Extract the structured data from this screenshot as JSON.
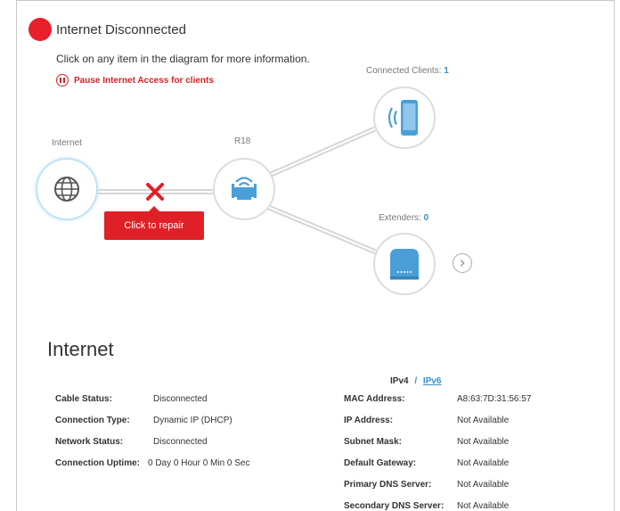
{
  "status": {
    "text": "Internet Disconnected",
    "instruction": "Click on any item in the diagram for more information.",
    "pause_label": "Pause Internet Access for clients"
  },
  "diagram": {
    "internet_label": "Internet",
    "router_label": "R18",
    "clients_label": "Connected Clients:",
    "clients_count": "1",
    "extenders_label": "Extenders:",
    "extenders_count": "0",
    "repair_label": "Click to repair"
  },
  "section": {
    "title": "Internet",
    "ipv4": "IPv4",
    "sep": "/",
    "ipv6": "IPv6"
  },
  "left_info": [
    {
      "label": "Cable Status:",
      "value": "Disconnected"
    },
    {
      "label": "Connection Type:",
      "value": "Dynamic IP (DHCP)"
    },
    {
      "label": "Network Status:",
      "value": "Disconnected"
    },
    {
      "label": "Connection Uptime:",
      "value": "0 Day 0 Hour 0 Min 0 Sec"
    }
  ],
  "right_info": [
    {
      "label": "MAC Address:",
      "value": "A8:63:7D:31:56:57"
    },
    {
      "label": "IP Address:",
      "value": "Not Available"
    },
    {
      "label": "Subnet Mask:",
      "value": "Not Available"
    },
    {
      "label": "Default Gateway:",
      "value": "Not Available"
    },
    {
      "label": "Primary DNS Server:",
      "value": "Not Available"
    },
    {
      "label": "Secondary DNS Server:",
      "value": "Not Available"
    }
  ],
  "colors": {
    "status_red": "#e8202a",
    "accent_blue": "#3a8fc9",
    "device_blue": "#4a9fd8"
  }
}
